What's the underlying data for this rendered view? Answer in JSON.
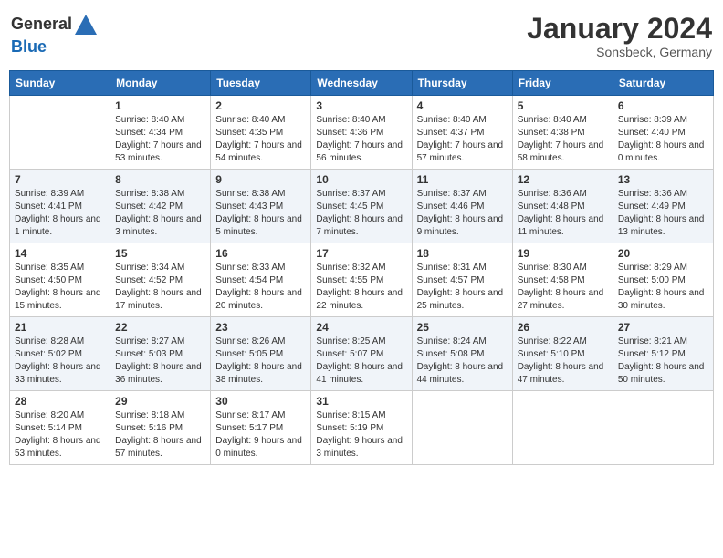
{
  "header": {
    "logo_general": "General",
    "logo_blue": "Blue",
    "month_title": "January 2024",
    "subtitle": "Sonsbeck, Germany"
  },
  "weekdays": [
    "Sunday",
    "Monday",
    "Tuesday",
    "Wednesday",
    "Thursday",
    "Friday",
    "Saturday"
  ],
  "weeks": [
    [
      {
        "day": "",
        "sunrise": "",
        "sunset": "",
        "daylight": ""
      },
      {
        "day": "1",
        "sunrise": "Sunrise: 8:40 AM",
        "sunset": "Sunset: 4:34 PM",
        "daylight": "Daylight: 7 hours and 53 minutes."
      },
      {
        "day": "2",
        "sunrise": "Sunrise: 8:40 AM",
        "sunset": "Sunset: 4:35 PM",
        "daylight": "Daylight: 7 hours and 54 minutes."
      },
      {
        "day": "3",
        "sunrise": "Sunrise: 8:40 AM",
        "sunset": "Sunset: 4:36 PM",
        "daylight": "Daylight: 7 hours and 56 minutes."
      },
      {
        "day": "4",
        "sunrise": "Sunrise: 8:40 AM",
        "sunset": "Sunset: 4:37 PM",
        "daylight": "Daylight: 7 hours and 57 minutes."
      },
      {
        "day": "5",
        "sunrise": "Sunrise: 8:40 AM",
        "sunset": "Sunset: 4:38 PM",
        "daylight": "Daylight: 7 hours and 58 minutes."
      },
      {
        "day": "6",
        "sunrise": "Sunrise: 8:39 AM",
        "sunset": "Sunset: 4:40 PM",
        "daylight": "Daylight: 8 hours and 0 minutes."
      }
    ],
    [
      {
        "day": "7",
        "sunrise": "Sunrise: 8:39 AM",
        "sunset": "Sunset: 4:41 PM",
        "daylight": "Daylight: 8 hours and 1 minute."
      },
      {
        "day": "8",
        "sunrise": "Sunrise: 8:38 AM",
        "sunset": "Sunset: 4:42 PM",
        "daylight": "Daylight: 8 hours and 3 minutes."
      },
      {
        "day": "9",
        "sunrise": "Sunrise: 8:38 AM",
        "sunset": "Sunset: 4:43 PM",
        "daylight": "Daylight: 8 hours and 5 minutes."
      },
      {
        "day": "10",
        "sunrise": "Sunrise: 8:37 AM",
        "sunset": "Sunset: 4:45 PM",
        "daylight": "Daylight: 8 hours and 7 minutes."
      },
      {
        "day": "11",
        "sunrise": "Sunrise: 8:37 AM",
        "sunset": "Sunset: 4:46 PM",
        "daylight": "Daylight: 8 hours and 9 minutes."
      },
      {
        "day": "12",
        "sunrise": "Sunrise: 8:36 AM",
        "sunset": "Sunset: 4:48 PM",
        "daylight": "Daylight: 8 hours and 11 minutes."
      },
      {
        "day": "13",
        "sunrise": "Sunrise: 8:36 AM",
        "sunset": "Sunset: 4:49 PM",
        "daylight": "Daylight: 8 hours and 13 minutes."
      }
    ],
    [
      {
        "day": "14",
        "sunrise": "Sunrise: 8:35 AM",
        "sunset": "Sunset: 4:50 PM",
        "daylight": "Daylight: 8 hours and 15 minutes."
      },
      {
        "day": "15",
        "sunrise": "Sunrise: 8:34 AM",
        "sunset": "Sunset: 4:52 PM",
        "daylight": "Daylight: 8 hours and 17 minutes."
      },
      {
        "day": "16",
        "sunrise": "Sunrise: 8:33 AM",
        "sunset": "Sunset: 4:54 PM",
        "daylight": "Daylight: 8 hours and 20 minutes."
      },
      {
        "day": "17",
        "sunrise": "Sunrise: 8:32 AM",
        "sunset": "Sunset: 4:55 PM",
        "daylight": "Daylight: 8 hours and 22 minutes."
      },
      {
        "day": "18",
        "sunrise": "Sunrise: 8:31 AM",
        "sunset": "Sunset: 4:57 PM",
        "daylight": "Daylight: 8 hours and 25 minutes."
      },
      {
        "day": "19",
        "sunrise": "Sunrise: 8:30 AM",
        "sunset": "Sunset: 4:58 PM",
        "daylight": "Daylight: 8 hours and 27 minutes."
      },
      {
        "day": "20",
        "sunrise": "Sunrise: 8:29 AM",
        "sunset": "Sunset: 5:00 PM",
        "daylight": "Daylight: 8 hours and 30 minutes."
      }
    ],
    [
      {
        "day": "21",
        "sunrise": "Sunrise: 8:28 AM",
        "sunset": "Sunset: 5:02 PM",
        "daylight": "Daylight: 8 hours and 33 minutes."
      },
      {
        "day": "22",
        "sunrise": "Sunrise: 8:27 AM",
        "sunset": "Sunset: 5:03 PM",
        "daylight": "Daylight: 8 hours and 36 minutes."
      },
      {
        "day": "23",
        "sunrise": "Sunrise: 8:26 AM",
        "sunset": "Sunset: 5:05 PM",
        "daylight": "Daylight: 8 hours and 38 minutes."
      },
      {
        "day": "24",
        "sunrise": "Sunrise: 8:25 AM",
        "sunset": "Sunset: 5:07 PM",
        "daylight": "Daylight: 8 hours and 41 minutes."
      },
      {
        "day": "25",
        "sunrise": "Sunrise: 8:24 AM",
        "sunset": "Sunset: 5:08 PM",
        "daylight": "Daylight: 8 hours and 44 minutes."
      },
      {
        "day": "26",
        "sunrise": "Sunrise: 8:22 AM",
        "sunset": "Sunset: 5:10 PM",
        "daylight": "Daylight: 8 hours and 47 minutes."
      },
      {
        "day": "27",
        "sunrise": "Sunrise: 8:21 AM",
        "sunset": "Sunset: 5:12 PM",
        "daylight": "Daylight: 8 hours and 50 minutes."
      }
    ],
    [
      {
        "day": "28",
        "sunrise": "Sunrise: 8:20 AM",
        "sunset": "Sunset: 5:14 PM",
        "daylight": "Daylight: 8 hours and 53 minutes."
      },
      {
        "day": "29",
        "sunrise": "Sunrise: 8:18 AM",
        "sunset": "Sunset: 5:16 PM",
        "daylight": "Daylight: 8 hours and 57 minutes."
      },
      {
        "day": "30",
        "sunrise": "Sunrise: 8:17 AM",
        "sunset": "Sunset: 5:17 PM",
        "daylight": "Daylight: 9 hours and 0 minutes."
      },
      {
        "day": "31",
        "sunrise": "Sunrise: 8:15 AM",
        "sunset": "Sunset: 5:19 PM",
        "daylight": "Daylight: 9 hours and 3 minutes."
      },
      {
        "day": "",
        "sunrise": "",
        "sunset": "",
        "daylight": ""
      },
      {
        "day": "",
        "sunrise": "",
        "sunset": "",
        "daylight": ""
      },
      {
        "day": "",
        "sunrise": "",
        "sunset": "",
        "daylight": ""
      }
    ]
  ]
}
